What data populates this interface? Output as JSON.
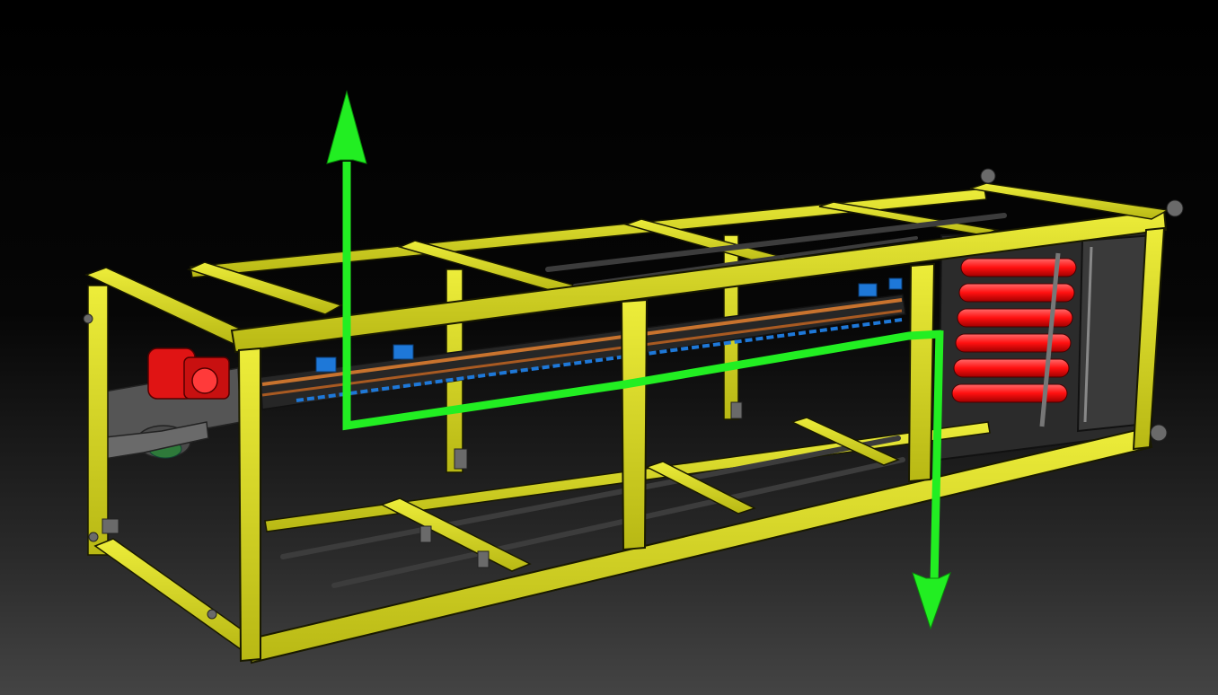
{
  "viewport": {
    "background_top": "#000000",
    "background_bottom": "#444444"
  },
  "model": {
    "frame_color": "#d8d81e",
    "frame_edge_color": "#1a1a00",
    "panel_color": "#2a2a2a",
    "rod_color": "#3a3a3a",
    "roller_color": "#ff1a1a",
    "motor_color": "#e01414",
    "rail_orange": "#c8732e",
    "rail_blue": "#1e78d8",
    "bracket_color": "#6a6a6a",
    "icons": [
      "gear-motor",
      "roller-stack",
      "carriage-rail"
    ]
  },
  "path_indicator": {
    "color": "#22ee22",
    "icons": [
      "arrow-up-icon",
      "arrow-down-icon"
    ]
  }
}
